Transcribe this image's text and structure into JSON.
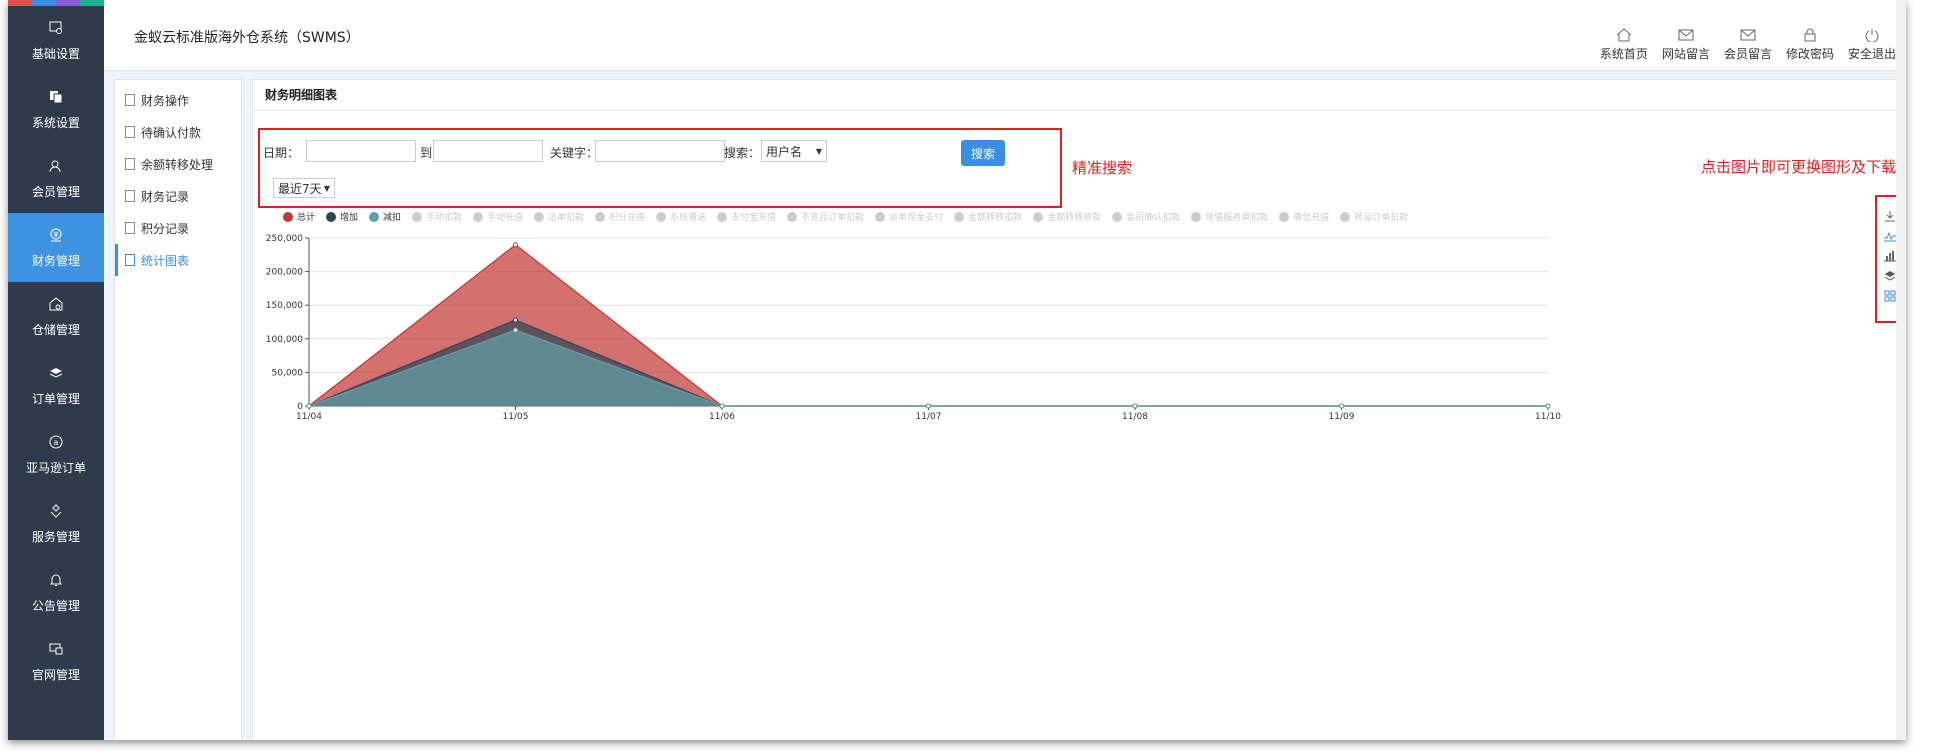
{
  "app": {
    "title": "金蚁云标准版海外仓系统（SWMS）"
  },
  "nav": [
    {
      "label": "基础设置",
      "icon": "settings-box-icon"
    },
    {
      "label": "系统设置",
      "icon": "copy-icon"
    },
    {
      "label": "会员管理",
      "icon": "user-icon"
    },
    {
      "label": "财务管理",
      "icon": "finance-icon",
      "active": true
    },
    {
      "label": "仓储管理",
      "icon": "warehouse-icon"
    },
    {
      "label": "订单管理",
      "icon": "layers-icon"
    },
    {
      "label": "亚马逊订单",
      "icon": "amazon-icon"
    },
    {
      "label": "服务管理",
      "icon": "service-icon"
    },
    {
      "label": "公告管理",
      "icon": "bell-icon"
    },
    {
      "label": "官网管理",
      "icon": "website-icon"
    }
  ],
  "top_links": [
    "系统首页",
    "网站留言",
    "会员留言",
    "修改密码",
    "安全退出"
  ],
  "submenu": [
    "财务操作",
    "待确认付款",
    "余额转移处理",
    "财务记录",
    "积分记录",
    "统计图表"
  ],
  "submenu_active": "统计图表",
  "panel": {
    "title": "财务明细图表"
  },
  "search": {
    "date_label": "日期：",
    "to_label": "到",
    "keyword_label": "关键字：",
    "search_by_label": "搜索：",
    "search_by_value": "用户名",
    "button": "搜索",
    "range_value": "最近7天"
  },
  "annotations": {
    "precise_search": "精准搜索",
    "click_hint": "点击图片即可更换图形及下载"
  },
  "legend": [
    {
      "name": "总计",
      "color": "#c23531",
      "active": true
    },
    {
      "name": "增加",
      "color": "#2f4554",
      "active": true
    },
    {
      "name": "减扣",
      "color": "#61a0a8",
      "active": true
    },
    {
      "name": "手动扣款",
      "active": false
    },
    {
      "name": "手动充值",
      "active": false
    },
    {
      "name": "运单扣款",
      "active": false
    },
    {
      "name": "积分兑换",
      "active": false
    },
    {
      "name": "系统赠送",
      "active": false
    },
    {
      "name": "支付宝充值",
      "active": false
    },
    {
      "name": "不良品订单扣款",
      "active": false
    },
    {
      "name": "运单现金支付",
      "active": false
    },
    {
      "name": "金额转移扣款",
      "active": false
    },
    {
      "name": "金额转移收款",
      "active": false
    },
    {
      "name": "会员确认扣款",
      "active": false
    },
    {
      "name": "增值服务单扣款",
      "active": false
    },
    {
      "name": "微信充值",
      "active": false
    },
    {
      "name": "转运订单扣款",
      "active": false
    }
  ],
  "toolbox": [
    "download-icon",
    "line-chart-icon",
    "bar-chart-icon",
    "stack-icon",
    "tiled-icon"
  ],
  "chart_data": {
    "type": "area",
    "categories": [
      "11/04",
      "11/05",
      "11/06",
      "11/07",
      "11/08",
      "11/09",
      "11/10"
    ],
    "ylim": [
      0,
      250000
    ],
    "yticks": [
      "0",
      "50,000",
      "100,000",
      "150,000",
      "200,000",
      "250,000"
    ],
    "grid": true,
    "legend_position": "top-left",
    "series": [
      {
        "name": "总计",
        "color": "#c23531",
        "values": [
          0,
          240000,
          0,
          0,
          0,
          0,
          0
        ]
      },
      {
        "name": "增加",
        "color": "#2f4554",
        "values": [
          0,
          128000,
          0,
          0,
          0,
          0,
          0
        ]
      },
      {
        "name": "减扣",
        "color": "#61a0a8",
        "values": [
          0,
          113000,
          0,
          0,
          0,
          0,
          0
        ]
      }
    ]
  }
}
